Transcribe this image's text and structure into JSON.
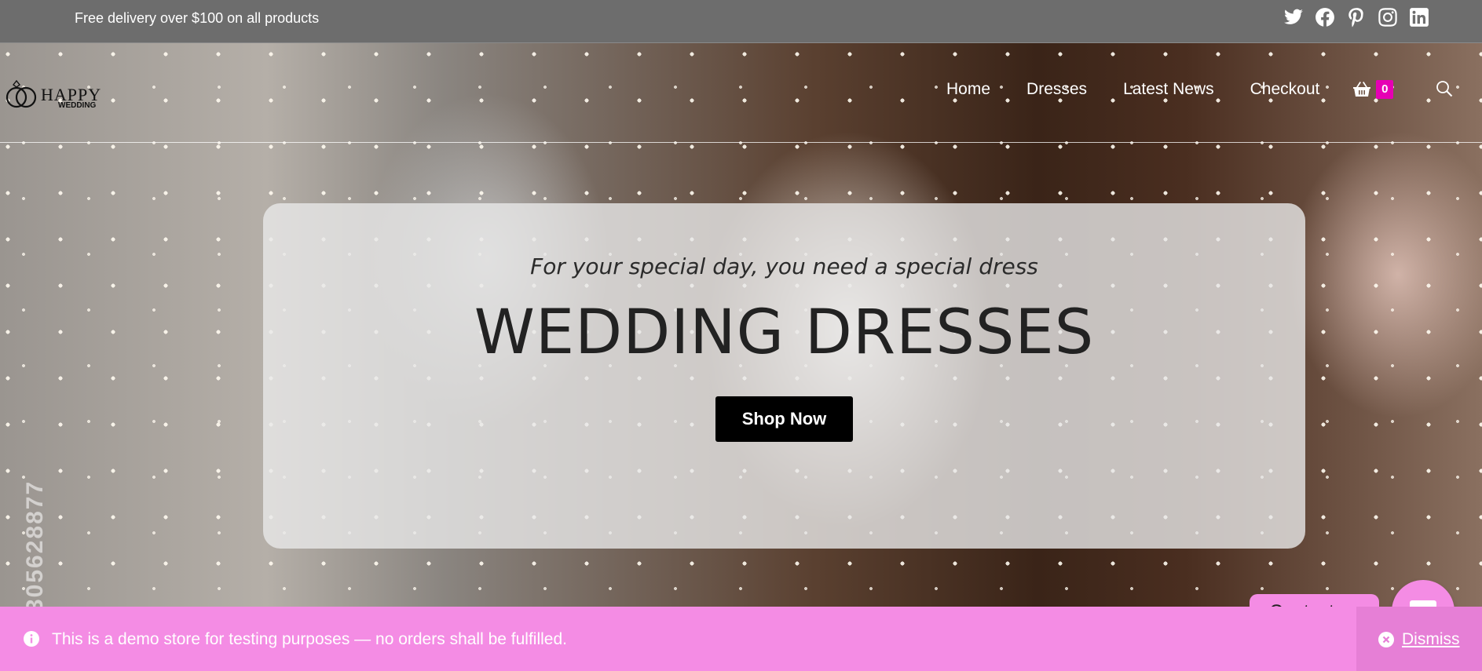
{
  "topbar": {
    "promo_text": "Free delivery over $100 on all products",
    "social": [
      "twitter-icon",
      "facebook-icon",
      "pinterest-icon",
      "instagram-icon",
      "linkedin-icon"
    ]
  },
  "header": {
    "logo": {
      "main": "HAPPY",
      "sub": "WEDDING"
    },
    "nav": [
      "Home",
      "Dresses",
      "Latest News",
      "Checkout"
    ],
    "cart_count": "0",
    "cart_badge_color": "#e600b4"
  },
  "hero": {
    "subtitle": "For your special day, you need a special dress",
    "title": "WEDDING DRESSES",
    "cta": "Shop Now",
    "watermark_number": "305628877"
  },
  "notice": {
    "text": "This is a demo store for testing purposes — no orders shall be fulfilled.",
    "dismiss": "Dismiss",
    "background": "#f48ce4"
  },
  "contact": {
    "label": "Contact us"
  }
}
